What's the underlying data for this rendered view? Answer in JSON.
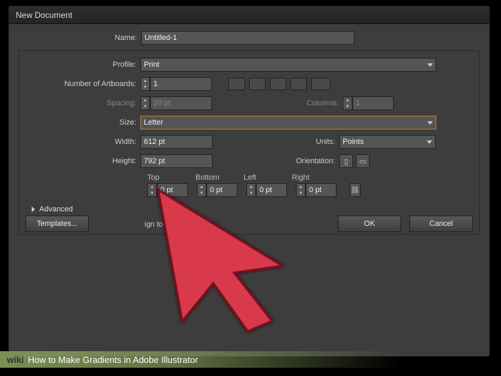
{
  "window_title": "New Document",
  "labels": {
    "name": "Name:",
    "profile": "Profile:",
    "num_artboards": "Number of Artboards:",
    "spacing": "Spacing:",
    "columns": "Columns:",
    "size": "Size:",
    "width": "Width:",
    "height": "Height:",
    "units": "Units:",
    "orientation": "Orientation:",
    "advanced": "Advanced",
    "templates_btn": "Templates...",
    "ok_btn": "OK",
    "cancel_btn": "Cancel"
  },
  "bleed": {
    "top_h": "Top",
    "bottom_h": "Bottom",
    "left_h": "Left",
    "right_h": "Right",
    "top": "0 pt",
    "bottom": "0 pt",
    "left": "0 pt",
    "right": "0 pt"
  },
  "values": {
    "name": "Untitled-1",
    "profile": "Print",
    "artboards": "1",
    "spacing": "20 pt",
    "columns": "1",
    "size": "Letter",
    "width": "612 pt",
    "height": "792 pt",
    "units": "Points"
  },
  "footer_text": "ign to Pixel Grid:No",
  "wiki": {
    "brand": "wiki",
    "title": "How to Make Gradients in Adobe Illustrator"
  }
}
